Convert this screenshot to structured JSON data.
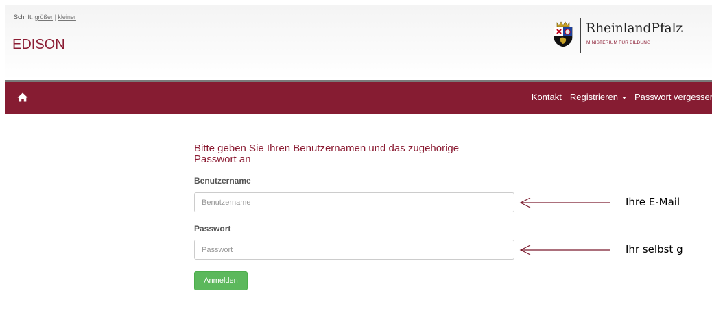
{
  "header": {
    "font_size_label": "Schrift:",
    "font_larger": "größer",
    "font_separator": "|",
    "font_smaller": "kleiner",
    "app_title": "EDISON",
    "logo": {
      "state_name": "RheinlandPfalz",
      "ministry": "MINISTERIUM FÜR BILDUNG",
      "icon": "coat-of-arms"
    }
  },
  "navbar": {
    "home_icon": "home-icon",
    "links": {
      "contact": "Kontakt",
      "register": "Registrieren",
      "forgot_password": "Passwort vergessen"
    }
  },
  "login": {
    "heading_line1": "Bitte geben Sie Ihren Benutzernamen und das zugehörige",
    "heading_line2": "Passwort an",
    "username_label": "Benutzername",
    "username_placeholder": "Benutzername",
    "username_value": "",
    "password_label": "Passwort",
    "password_placeholder": "Passwort",
    "password_value": "",
    "submit_label": "Anmelden"
  },
  "annotations": {
    "username_hint": "Ihre E-Mail",
    "password_hint": "Ihr selbst g"
  },
  "colors": {
    "brand": "#861c32",
    "title": "#8b1c33",
    "button": "#5cb85c"
  }
}
